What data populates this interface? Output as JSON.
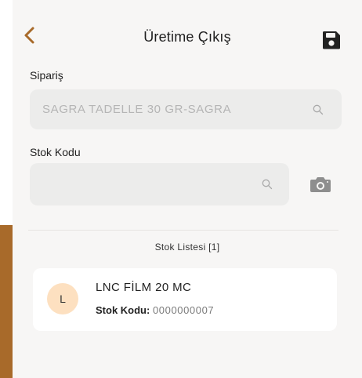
{
  "header": {
    "title": "Üretime Çıkış",
    "back_icon": "chevron-left-icon",
    "save_icon": "floppy-disk-icon"
  },
  "order": {
    "label": "Sipariş",
    "value": "SAGRA TADELLE 30 GR-SAGRA",
    "icon": "search-icon"
  },
  "stock_code": {
    "label": "Stok Kodu",
    "value": "",
    "search_icon": "search-icon",
    "camera_icon": "camera-icon"
  },
  "stock_list": {
    "title": "Stok Listesi [1]",
    "items": [
      {
        "avatar_letter": "L",
        "name": "LNC FİLM 20 MC",
        "code_label": "Stok Kodu:",
        "code_value": "0000000007"
      }
    ]
  },
  "colors": {
    "accent": "#a86a2a",
    "avatar_bg": "#fde0c0",
    "field_bg": "#ececeb",
    "panel_bg": "#f7f6f5"
  }
}
